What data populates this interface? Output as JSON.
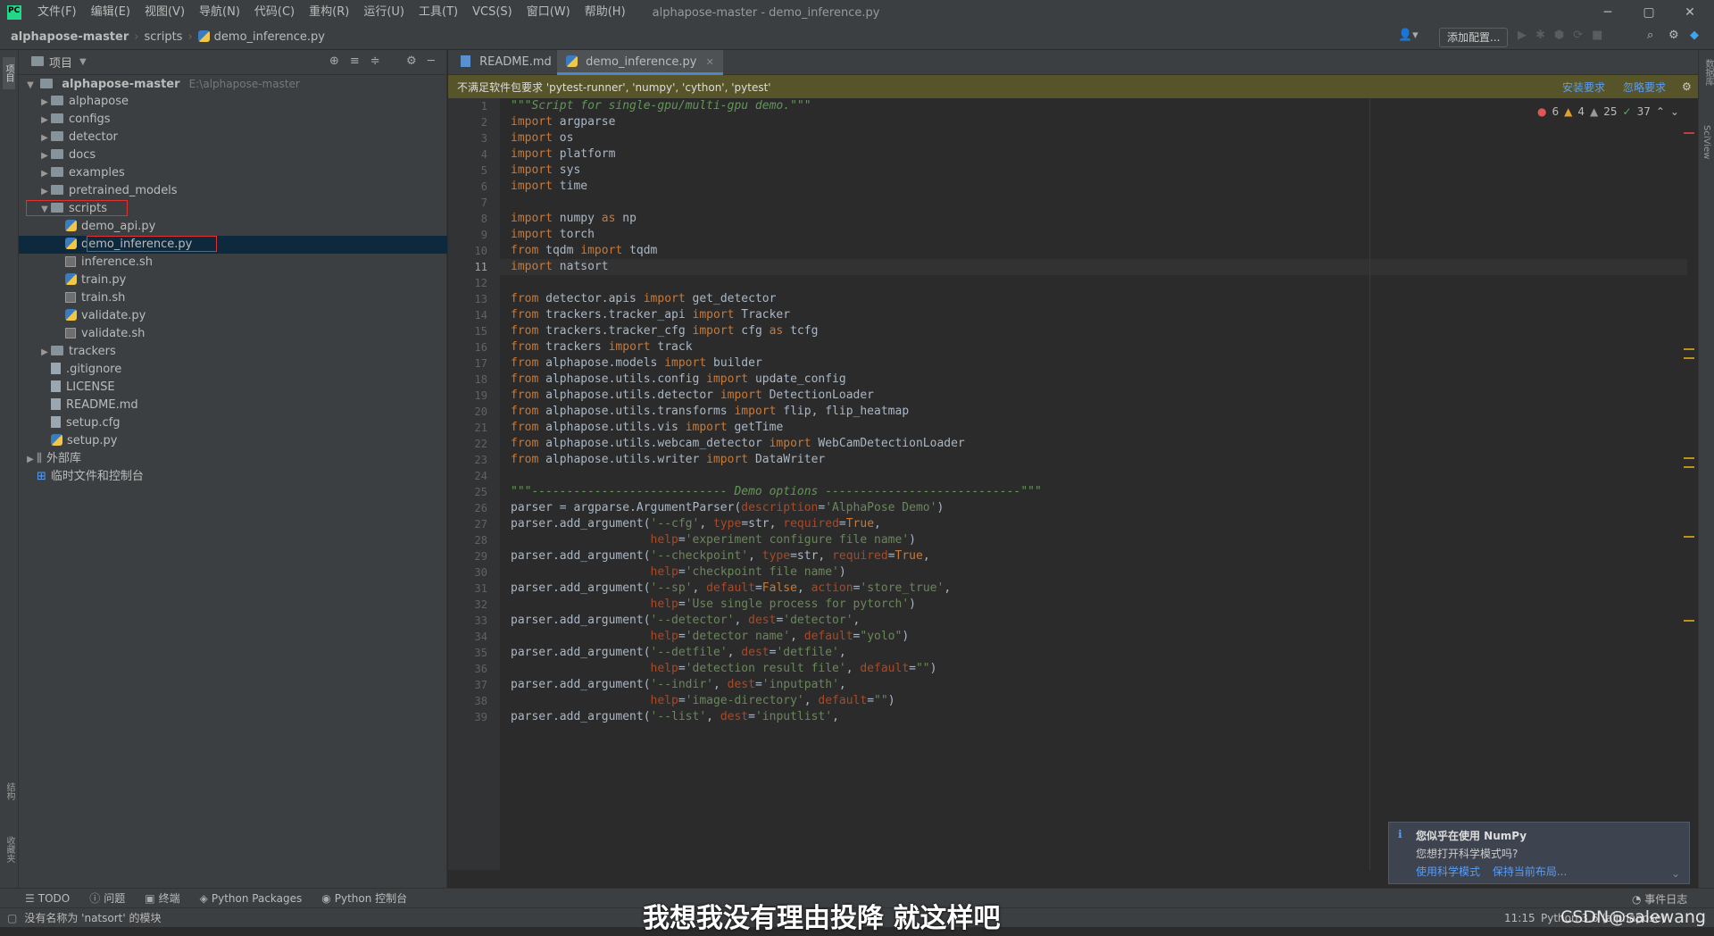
{
  "window": {
    "title": "alphapose-master - demo_inference.py",
    "menu": [
      "文件(F)",
      "编辑(E)",
      "视图(V)",
      "导航(N)",
      "代码(C)",
      "重构(R)",
      "运行(U)",
      "工具(T)",
      "VCS(S)",
      "窗口(W)",
      "帮助(H)"
    ],
    "min": "─",
    "max": "▢",
    "close": "✕"
  },
  "nav": {
    "crumbs": [
      "alphapose-master",
      "scripts",
      "demo_inference.py"
    ],
    "add_config": "添加配置..."
  },
  "project": {
    "header": "项目",
    "root_label": "alphapose-master",
    "root_path": "E:\\alphapose-master",
    "items": [
      {
        "label": "alphapose",
        "type": "folder",
        "depth": 1,
        "expanded": false
      },
      {
        "label": "configs",
        "type": "folder",
        "depth": 1,
        "expanded": false
      },
      {
        "label": "detector",
        "type": "folder",
        "depth": 1,
        "expanded": false
      },
      {
        "label": "docs",
        "type": "folder",
        "depth": 1,
        "expanded": false
      },
      {
        "label": "examples",
        "type": "folder",
        "depth": 1,
        "expanded": false
      },
      {
        "label": "pretrained_models",
        "type": "folder",
        "depth": 1,
        "expanded": false
      },
      {
        "label": "scripts",
        "type": "folder",
        "depth": 1,
        "expanded": true
      },
      {
        "label": "demo_api.py",
        "type": "py",
        "depth": 2
      },
      {
        "label": "demo_inference.py",
        "type": "py",
        "depth": 2,
        "selected": true
      },
      {
        "label": "inference.sh",
        "type": "sh",
        "depth": 2
      },
      {
        "label": "train.py",
        "type": "py",
        "depth": 2
      },
      {
        "label": "train.sh",
        "type": "sh",
        "depth": 2
      },
      {
        "label": "validate.py",
        "type": "py",
        "depth": 2
      },
      {
        "label": "validate.sh",
        "type": "sh",
        "depth": 2
      },
      {
        "label": "trackers",
        "type": "folder",
        "depth": 1,
        "expanded": false
      },
      {
        "label": ".gitignore",
        "type": "file",
        "depth": 1
      },
      {
        "label": "LICENSE",
        "type": "file",
        "depth": 1
      },
      {
        "label": "README.md",
        "type": "file",
        "depth": 1
      },
      {
        "label": "setup.cfg",
        "type": "file",
        "depth": 1
      },
      {
        "label": "setup.py",
        "type": "py",
        "depth": 1
      },
      {
        "label": "外部库",
        "type": "lib",
        "depth": 0,
        "expanded": false
      },
      {
        "label": "临时文件和控制台",
        "type": "scratch",
        "depth": 0
      }
    ]
  },
  "tabs": [
    {
      "label": "README.md",
      "active": false
    },
    {
      "label": "demo_inference.py",
      "active": true
    }
  ],
  "banner": {
    "text": "不满足软件包要求 'pytest-runner', 'numpy', 'cython', 'pytest'",
    "install": "安装要求",
    "ignore": "忽略要求"
  },
  "inspections": {
    "errors": "6",
    "warnings": "4",
    "weak": "25",
    "ok": "37"
  },
  "code_lines": [
    "\"\"\"Script for single-gpu/multi-gpu demo.\"\"\"",
    "import argparse",
    "import os",
    "import platform",
    "import sys",
    "import time",
    "",
    "import numpy as np",
    "import torch",
    "from tqdm import tqdm",
    "import natsort",
    "",
    "from detector.apis import get_detector",
    "from trackers.tracker_api import Tracker",
    "from trackers.tracker_cfg import cfg as tcfg",
    "from trackers import track",
    "from alphapose.models import builder",
    "from alphapose.utils.config import update_config",
    "from alphapose.utils.detector import DetectionLoader",
    "from alphapose.utils.transforms import flip, flip_heatmap",
    "from alphapose.utils.vis import getTime",
    "from alphapose.utils.webcam_detector import WebCamDetectionLoader",
    "from alphapose.utils.writer import DataWriter",
    "",
    "\"\"\"---------------------------- Demo options ----------------------------\"\"\"",
    "parser = argparse.ArgumentParser(description='AlphaPose Demo')",
    "parser.add_argument('--cfg', type=str, required=True,",
    "                    help='experiment configure file name')",
    "parser.add_argument('--checkpoint', type=str, required=True,",
    "                    help='checkpoint file name')",
    "parser.add_argument('--sp', default=False, action='store_true',",
    "                    help='Use single process for pytorch')",
    "parser.add_argument('--detector', dest='detector',",
    "                    help='detector name', default=\"yolo\")",
    "parser.add_argument('--detfile', dest='detfile',",
    "                    help='detection result file', default=\"\")",
    "parser.add_argument('--indir', dest='inputpath',",
    "                    help='image-directory', default=\"\")",
    "parser.add_argument('--list', dest='inputlist',"
  ],
  "bottom_tools": [
    "TODO",
    "问题",
    "终端",
    "Python Packages",
    "Python 控制台"
  ],
  "status": {
    "message": "没有名称为 'natsort' 的模块",
    "position": "11:15",
    "interpreter": "Python 3.6 (alphapose)",
    "event_log": "事件日志"
  },
  "notification": {
    "title": "您似乎在使用 NumPy",
    "body": "您想打开科学模式吗?",
    "action1": "使用科学模式",
    "action2": "保持当前布局..."
  },
  "overlay": {
    "subtitle": "我想我没有理由投降 就这样吧",
    "watermark": "CSDN@salewang"
  },
  "colors": {
    "accent": "#4a88c7",
    "selection": "#0d293e",
    "banner": "#57542a"
  }
}
